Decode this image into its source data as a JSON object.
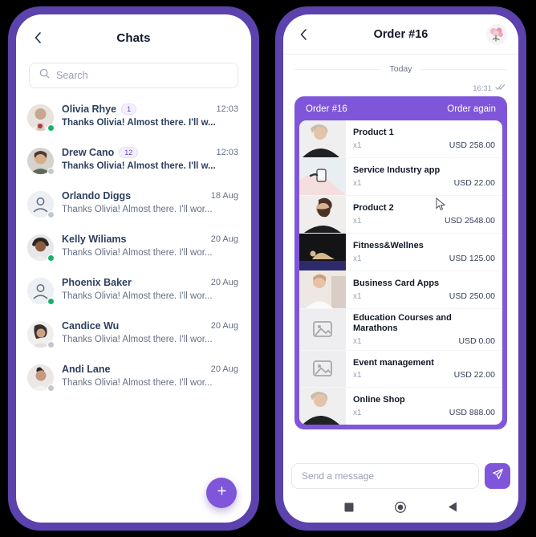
{
  "theme": {
    "frame_purple": "#5b42ac",
    "accent_purple": "#7f56d9",
    "badge_text": "#6941c6",
    "online_green": "#17b26a",
    "offline_grey": "#c3c8d0",
    "background": "#000000"
  },
  "left_phone": {
    "appbar": {
      "back_icon": "chevron-left-icon",
      "title": "Chats"
    },
    "search": {
      "icon": "search-icon",
      "placeholder": "Search",
      "value": ""
    },
    "fab": {
      "icon": "plus-icon",
      "label": "+"
    },
    "chats": [
      {
        "name": "Olivia Rhye",
        "badge": "1",
        "time": "12:03",
        "preview": "Thanks Olivia! Almost there. I'll w...",
        "unread": true,
        "status": "online",
        "avatar": "photo"
      },
      {
        "name": "Drew Cano",
        "badge": "12",
        "time": "12:03",
        "preview": "Thanks Olivia! Almost there. I'll w...",
        "unread": true,
        "status": "offline",
        "avatar": "photo"
      },
      {
        "name": "Orlando Diggs",
        "badge": "",
        "time": "18 Aug",
        "preview": "Thanks Olivia! Almost there. I'll wor...",
        "unread": false,
        "status": "offline",
        "avatar": "placeholder"
      },
      {
        "name": "Kelly Wiliams",
        "badge": "",
        "time": "20 Aug",
        "preview": "Thanks Olivia! Almost there. I'll wor...",
        "unread": false,
        "status": "online",
        "avatar": "photo"
      },
      {
        "name": "Phoenix Baker",
        "badge": "",
        "time": "20 Aug",
        "preview": "Thanks Olivia! Almost there. I'll wor...",
        "unread": false,
        "status": "online",
        "avatar": "placeholder"
      },
      {
        "name": "Candice Wu",
        "badge": "",
        "time": "20 Aug",
        "preview": "Thanks Olivia! Almost there. I'll wor...",
        "unread": false,
        "status": "offline",
        "avatar": "photo"
      },
      {
        "name": "Andi Lane",
        "badge": "",
        "time": "20 Aug",
        "preview": "Thanks Olivia! Almost there. I'll wor...",
        "unread": false,
        "status": "offline",
        "avatar": "photo"
      }
    ]
  },
  "right_phone": {
    "appbar": {
      "back_icon": "chevron-left-icon",
      "title": "Order #16",
      "avatar_icon": "flower-bouquet-avatar"
    },
    "conversation": {
      "day_separator": "Today",
      "message_time": "16:31",
      "read_receipt_icon": "double-check-icon"
    },
    "order_card": {
      "title": "Order #16",
      "action_label": "Order again",
      "items": [
        {
          "name": "Product 1",
          "qty": "x1",
          "price": "USD 258.00",
          "thumb": "photo"
        },
        {
          "name": "Service Industry app",
          "qty": "x1",
          "price": "USD 22.00",
          "thumb": "photo"
        },
        {
          "name": "Product 2",
          "qty": "x1",
          "price": "USD 2548.00",
          "thumb": "photo"
        },
        {
          "name": "Fitness&Wellnes",
          "qty": "x1",
          "price": "USD 125.00",
          "thumb": "photo"
        },
        {
          "name": "Business Card Apps",
          "qty": "x1",
          "price": "USD 250.00",
          "thumb": "photo"
        },
        {
          "name": "Education Courses and Marathons",
          "qty": "x1",
          "price": "USD 0.00",
          "thumb": "placeholder"
        },
        {
          "name": "Event management",
          "qty": "x1",
          "price": "USD 22.00",
          "thumb": "placeholder"
        },
        {
          "name": "Online Shop",
          "qty": "x1",
          "price": "USD 888.00",
          "thumb": "photo"
        }
      ]
    },
    "composer": {
      "placeholder": "Send a message",
      "value": "",
      "send_icon": "send-paper-plane-icon"
    },
    "navbar": {
      "recents_icon": "square-icon",
      "home_icon": "circle-icon",
      "back_icon": "triangle-back-icon"
    }
  }
}
